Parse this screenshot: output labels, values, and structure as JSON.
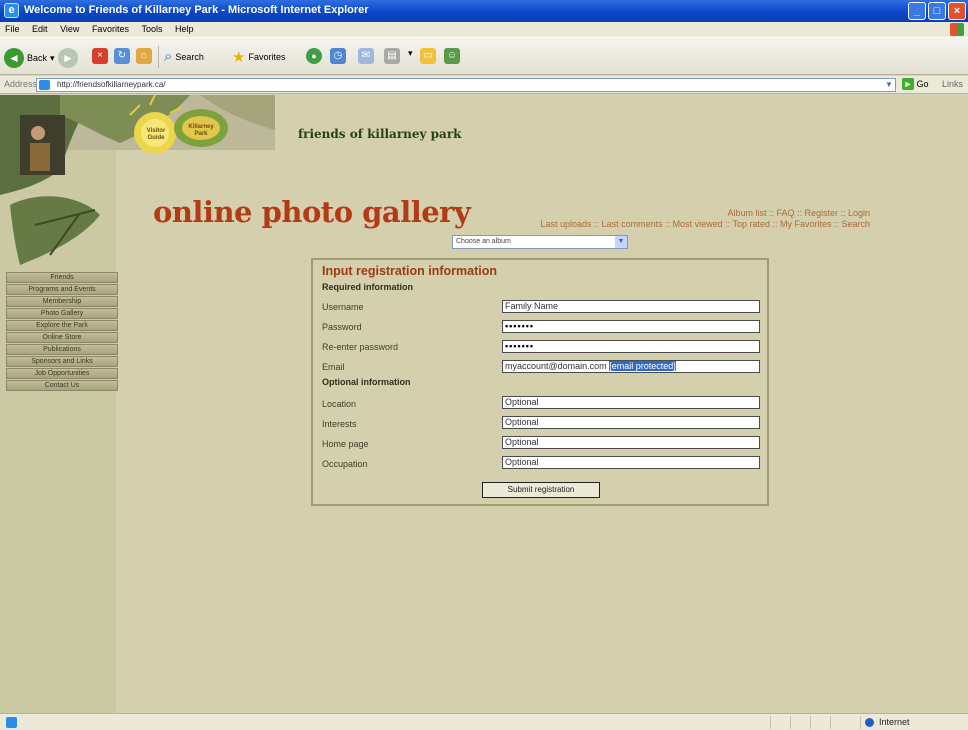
{
  "window": {
    "title": "Welcome to Friends of Killarney Park - Microsoft Internet Explorer"
  },
  "menubar": {
    "items": [
      "File",
      "Edit",
      "View",
      "Favorites",
      "Tools",
      "Help"
    ]
  },
  "toolbar": {
    "back": "Back",
    "search": "Search",
    "favorites": "Favorites"
  },
  "addressbar": {
    "label": "Address",
    "url": "http://friendsofkillarneypark.ca/",
    "go": "Go",
    "links": "Links"
  },
  "site": {
    "title": "friends of killarney park",
    "gallery_title": "online photo gallery",
    "sun_badge": "Visitor Guide",
    "leaf_badge": "Killarney Park"
  },
  "toplinks": {
    "row1": "Album list :: FAQ :: Register :: Login",
    "row2": "Last uploads :: Last comments :: Most viewed :: Top rated :: My Favorites :: Search"
  },
  "album_select": {
    "value": "Choose an album"
  },
  "nav": {
    "items": [
      "Friends",
      "Programs and Events",
      "Membership",
      "Photo Gallery",
      "Explore the Park",
      "Online Store",
      "Publications",
      "Sponsors and Links",
      "Job Opportunities",
      "Contact Us"
    ]
  },
  "form": {
    "title": "Input registration information",
    "required_header": "Required information",
    "optional_header": "Optional information",
    "fields": {
      "username": {
        "label": "Username",
        "value": "Family Name"
      },
      "password": {
        "label": "Password",
        "value": "•••••••"
      },
      "reenter": {
        "label": "Re-enter password",
        "value": "•••••••"
      },
      "email": {
        "label": "Email",
        "value": "myaccount@domain.com",
        "selected": "[email protected]"
      },
      "location": {
        "label": "Location",
        "value": "Optional"
      },
      "interests": {
        "label": "Interests",
        "value": "Optional"
      },
      "homepage": {
        "label": "Home page",
        "value": "Optional"
      },
      "occupation": {
        "label": "Occupation",
        "value": "Optional"
      }
    },
    "submit": "Submit registration"
  },
  "statusbar": {
    "zone": "Internet"
  },
  "colors": {
    "page_bg": "#d4d0ad",
    "gallery_title": "#b23b16",
    "form_title": "#9a3b14",
    "titlebar": "#0a46c8"
  }
}
